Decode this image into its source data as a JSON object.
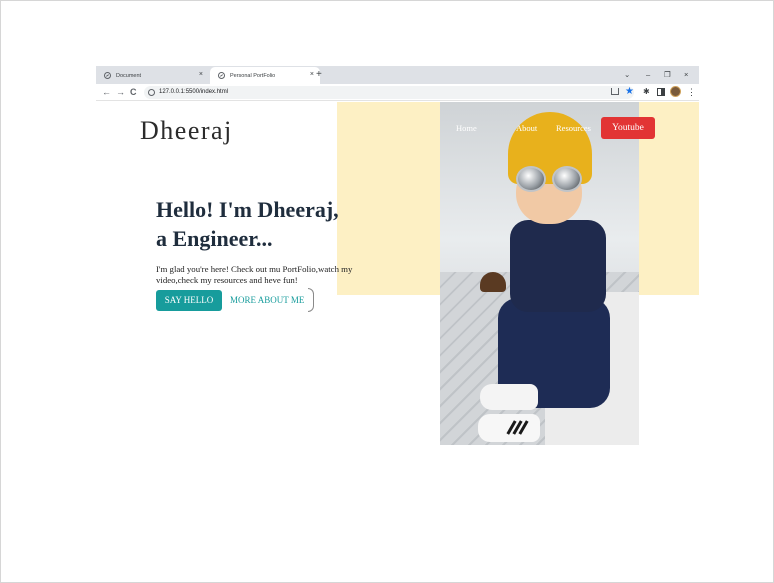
{
  "browser": {
    "tabs": [
      {
        "title": "Document",
        "close": "×"
      },
      {
        "title": "Personal PortFolio",
        "close": "×"
      }
    ],
    "new_tab": "+",
    "window_controls": {
      "chevron": "⌄",
      "minimize": "–",
      "restore": "❐",
      "close": "×"
    },
    "nav": {
      "back": "←",
      "forward": "→",
      "reload": "C"
    },
    "url": "127.0.0.1:5500/index.html",
    "toolbar_icons": [
      "share-icon",
      "star-icon",
      "extensions-icon",
      "side-panel-icon",
      "profile-avatar",
      "menu-icon"
    ],
    "star_glyph": "★",
    "puzzle_glyph": "✱",
    "kebab_glyph": "⋮"
  },
  "page": {
    "logo": "Dheeraj",
    "nav_items": [
      "Home",
      "About",
      "Resources"
    ],
    "youtube_button": "Youtube",
    "hero_title_line1": "Hello! I'm Dheeraj,",
    "hero_title_line2": "a Engineer...",
    "hero_text": "I'm glad you're here! Check out mu PortFolio,watch my video,check my resources and heve fun!",
    "say_hello": "SAY HELLO",
    "more_about": "MORE ABOUT ME",
    "colors": {
      "accent_teal": "#179c9c",
      "youtube_red": "#e23434",
      "yellow_block": "#fdf0c4",
      "heading": "#1f2d3d"
    }
  }
}
